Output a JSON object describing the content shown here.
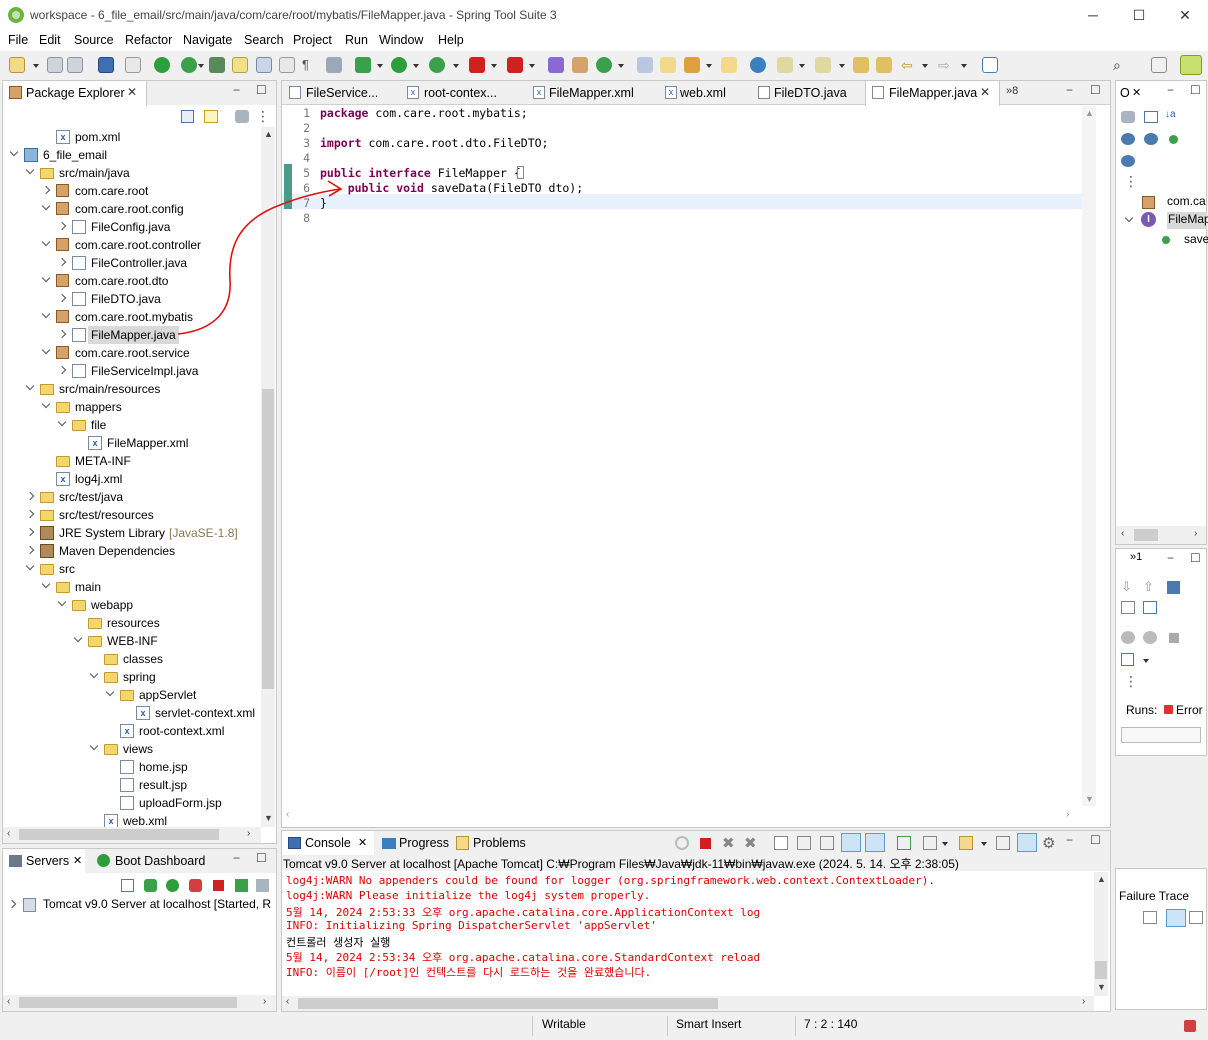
{
  "window": {
    "title": "workspace - 6_file_email/src/main/java/com/care/root/mybatis/FileMapper.java - Spring Tool Suite 3",
    "minimize": "─",
    "maximize": "☐",
    "close": "✕"
  },
  "menu": [
    "File",
    "Edit",
    "Source",
    "Refactor",
    "Navigate",
    "Search",
    "Project",
    "Run",
    "Window",
    "Help"
  ],
  "package_explorer": {
    "tab_label": "Package Explorer",
    "tree": [
      {
        "label": "pom.xml",
        "indent": 2,
        "icon": "xml-file-icon",
        "tw": ""
      },
      {
        "label": "6_file_email",
        "indent": 0,
        "icon": "project-icon",
        "tw": "d"
      },
      {
        "label": "src/main/java",
        "indent": 1,
        "icon": "source-folder-icon",
        "tw": "d"
      },
      {
        "label": "com.care.root",
        "indent": 2,
        "icon": "package-icon",
        "tw": "r"
      },
      {
        "label": "com.care.root.config",
        "indent": 2,
        "icon": "package-icon",
        "tw": "d"
      },
      {
        "label": "FileConfig.java",
        "indent": 3,
        "icon": "java-file-icon",
        "tw": "r"
      },
      {
        "label": "com.care.root.controller",
        "indent": 2,
        "icon": "package-icon",
        "tw": "d"
      },
      {
        "label": "FileController.java",
        "indent": 3,
        "icon": "java-file-icon",
        "tw": "r"
      },
      {
        "label": "com.care.root.dto",
        "indent": 2,
        "icon": "package-icon",
        "tw": "d"
      },
      {
        "label": "FileDTO.java",
        "indent": 3,
        "icon": "java-file-icon",
        "tw": "r"
      },
      {
        "label": "com.care.root.mybatis",
        "indent": 2,
        "icon": "package-icon",
        "tw": "d"
      },
      {
        "label": "FileMapper.java",
        "indent": 3,
        "icon": "java-file-icon",
        "tw": "r",
        "selected": true
      },
      {
        "label": "com.care.root.service",
        "indent": 2,
        "icon": "package-icon",
        "tw": "d"
      },
      {
        "label": "FileServiceImpl.java",
        "indent": 3,
        "icon": "java-file-icon",
        "tw": "r"
      },
      {
        "label": "src/main/resources",
        "indent": 1,
        "icon": "source-folder-icon",
        "tw": "d"
      },
      {
        "label": "mappers",
        "indent": 2,
        "icon": "folder-icon",
        "tw": "d"
      },
      {
        "label": "file",
        "indent": 3,
        "icon": "folder-icon",
        "tw": "d"
      },
      {
        "label": "FileMapper.xml",
        "indent": 4,
        "icon": "xml-file-icon",
        "tw": ""
      },
      {
        "label": "META-INF",
        "indent": 2,
        "icon": "folder-icon",
        "tw": ""
      },
      {
        "label": "log4j.xml",
        "indent": 2,
        "icon": "xml-file-icon",
        "tw": ""
      },
      {
        "label": "src/test/java",
        "indent": 1,
        "icon": "source-folder-icon",
        "tw": "r"
      },
      {
        "label": "src/test/resources",
        "indent": 1,
        "icon": "source-folder-icon",
        "tw": "r"
      },
      {
        "label": "JRE System Library",
        "suffix": "[JavaSE-1.8]",
        "indent": 1,
        "icon": "library-icon",
        "tw": "r"
      },
      {
        "label": "Maven Dependencies",
        "indent": 1,
        "icon": "library-icon",
        "tw": "r"
      },
      {
        "label": "src",
        "indent": 1,
        "icon": "folder-icon",
        "tw": "d"
      },
      {
        "label": "main",
        "indent": 2,
        "icon": "folder-icon",
        "tw": "d"
      },
      {
        "label": "webapp",
        "indent": 3,
        "icon": "folder-icon",
        "tw": "d"
      },
      {
        "label": "resources",
        "indent": 4,
        "icon": "folder-icon",
        "tw": ""
      },
      {
        "label": "WEB-INF",
        "indent": 4,
        "icon": "folder-icon",
        "tw": "d"
      },
      {
        "label": "classes",
        "indent": 5,
        "icon": "folder-icon",
        "tw": ""
      },
      {
        "label": "spring",
        "indent": 5,
        "icon": "folder-icon",
        "tw": "d"
      },
      {
        "label": "appServlet",
        "indent": 6,
        "icon": "folder-icon",
        "tw": "d"
      },
      {
        "label": "servlet-context.xml",
        "indent": 7,
        "icon": "xml-file-icon",
        "tw": ""
      },
      {
        "label": "root-context.xml",
        "indent": 6,
        "icon": "xml-file-icon",
        "tw": ""
      },
      {
        "label": "views",
        "indent": 5,
        "icon": "folder-icon",
        "tw": "d"
      },
      {
        "label": "home.jsp",
        "indent": 6,
        "icon": "file-icon",
        "tw": ""
      },
      {
        "label": "result.jsp",
        "indent": 6,
        "icon": "file-icon",
        "tw": ""
      },
      {
        "label": "uploadForm.jsp",
        "indent": 6,
        "icon": "file-icon",
        "tw": ""
      },
      {
        "label": "web.xml",
        "indent": 5,
        "icon": "xml-file-icon",
        "tw": ""
      }
    ]
  },
  "editor": {
    "tabs": [
      "FileService...",
      "root-contex...",
      "FileMapper.xml",
      "web.xml",
      "FileDTO.java",
      "FileMapper.java"
    ],
    "active_tab": "FileMapper.java",
    "overflow_count": "»8",
    "lines": [
      {
        "n": "1",
        "tokens": [
          {
            "t": "package",
            "k": true
          },
          {
            "t": " com.care.root.mybatis;",
            "k": false
          }
        ]
      },
      {
        "n": "2",
        "tokens": []
      },
      {
        "n": "3",
        "tokens": [
          {
            "t": "import",
            "k": true
          },
          {
            "t": " com.care.root.dto.FileDTO;",
            "k": false
          }
        ]
      },
      {
        "n": "4",
        "tokens": []
      },
      {
        "n": "5",
        "tokens": [
          {
            "t": "public",
            "k": true
          },
          {
            "t": " ",
            "k": false
          },
          {
            "t": "interface",
            "k": true
          },
          {
            "t": " FileMapper {",
            "k": false
          }
        ]
      },
      {
        "n": "6",
        "tokens": [
          {
            "t": "    ",
            "k": false
          },
          {
            "t": "public",
            "k": true
          },
          {
            "t": " ",
            "k": false
          },
          {
            "t": "void",
            "k": true
          },
          {
            "t": " saveData(FileDTO dto);",
            "k": false
          }
        ]
      },
      {
        "n": "7",
        "tokens": [
          {
            "t": "}",
            "k": false
          }
        ]
      },
      {
        "n": "8",
        "tokens": []
      }
    ]
  },
  "outline": {
    "tab_label": "O",
    "items": [
      "com.ca",
      "FileMap",
      "save"
    ]
  },
  "junit": {
    "overflow": "»1",
    "runs_label": "Runs:",
    "errors_label": "Error",
    "failure_trace": "Failure Trace"
  },
  "servers": {
    "tab_label": "Servers",
    "boot_tab_label": "Boot Dashboard",
    "server_entry": "Tomcat v9.0 Server at localhost  [Started, R"
  },
  "console": {
    "tabs": [
      "Console",
      "Progress",
      "Problems"
    ],
    "header": "Tomcat v9.0 Server at localhost [Apache Tomcat] C:₩Program Files₩Java₩jdk-11₩bin₩javaw.exe  (2024. 5. 14. 오후 2:38:05)",
    "lines": [
      {
        "text": "log4j:WARN No appenders could be found for logger (org.springframework.web.context.ContextLoader).",
        "color": "red"
      },
      {
        "text": "log4j:WARN Please initialize the log4j system properly.",
        "color": "red"
      },
      {
        "text": "5월 14, 2024 2:53:33 오후 org.apache.catalina.core.ApplicationContext log",
        "color": "red"
      },
      {
        "text": "INFO: Initializing Spring DispatcherServlet 'appServlet'",
        "color": "red"
      },
      {
        "text": "컨트롤러 생성자 실행",
        "color": "black"
      },
      {
        "text": "5월 14, 2024 2:53:34 오후 org.apache.catalina.core.StandardContext reload",
        "color": "red"
      },
      {
        "text": "INFO: 이름이 [/root]인 컨텍스트를 다시 로드하는 것을 완료했습니다.",
        "color": "red"
      }
    ]
  },
  "status": {
    "writable": "Writable",
    "insert_mode": "Smart Insert",
    "position": "7 : 2 : 140"
  },
  "colors": {
    "keyword": "#7f0055",
    "console_error": "#e00000",
    "annotation_arrow": "#e01010",
    "current_line": "#e8f2fe",
    "selection": "#d9d9d9"
  }
}
